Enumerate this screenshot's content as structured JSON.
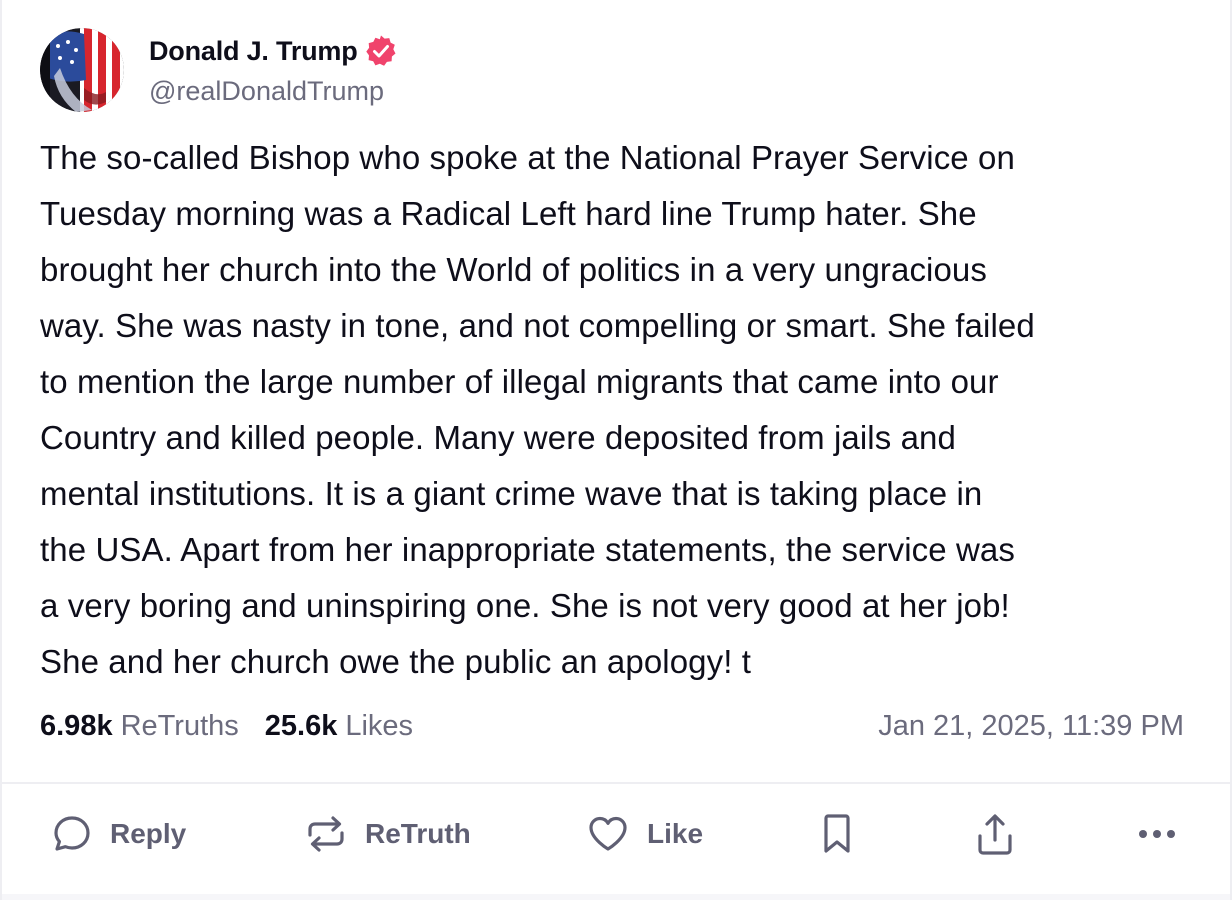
{
  "author": {
    "display_name": "Donald J. Trump",
    "handle": "@realDonaldTrump",
    "verified": true,
    "verified_color": "#f0436c"
  },
  "post": {
    "text": "The so-called Bishop who spoke at the National Prayer Service on\nTuesday morning was a Radical Left hard line Trump hater. She\nbrought her church into the World of politics in a very ungracious\nway. She was nasty in tone, and not compelling or smart. She failed\nto mention the large number of illegal migrants that came into our\nCountry and killed people. Many were deposited from jails and\nmental institutions. It is a giant crime wave that is taking place in\nthe USA. Apart from her inappropriate statements, the service was\na very boring and uninspiring one. She is not very good at her job!\nShe and her church owe the public an apology! t",
    "retruths_count": "6.98k",
    "retruths_label": "ReTruths",
    "likes_count": "25.6k",
    "likes_label": "Likes",
    "timestamp": "Jan 21, 2025, 11:39 PM"
  },
  "actions": {
    "reply_label": "Reply",
    "retruth_label": "ReTruth",
    "like_label": "Like",
    "icons": [
      "reply-icon",
      "retruth-icon",
      "heart-icon",
      "bookmark-icon",
      "share-icon",
      "more-icon"
    ]
  },
  "colors": {
    "text": "#0e0e1a",
    "muted": "#6b6b7d",
    "action": "#5f5f73",
    "divider": "#eeeef2"
  }
}
